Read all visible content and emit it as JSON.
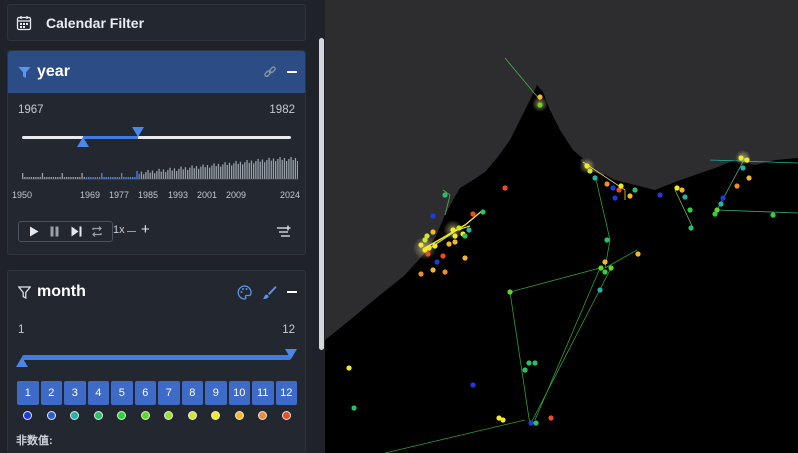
{
  "calendar_filter": {
    "title": "Calendar Filter",
    "icon": "calendar-icon"
  },
  "year_filter": {
    "title": "year",
    "range_min": "1967",
    "range_max": "1982",
    "selected_range": [
      1967,
      1982
    ],
    "axis_ticks": [
      "1950",
      "1969",
      "1977",
      "1985",
      "1993",
      "2001",
      "2009",
      "2024"
    ],
    "speed": "1x",
    "icons": [
      "filter-icon",
      "link-icon",
      "minus-icon",
      "play-icon",
      "pause-icon",
      "step-forward-icon",
      "loop-icon",
      "add-filter-icon"
    ]
  },
  "month_filter": {
    "title": "month",
    "range_min": "1",
    "range_max": "12",
    "months": [
      "1",
      "2",
      "3",
      "4",
      "5",
      "6",
      "7",
      "8",
      "9",
      "10",
      "11",
      "12"
    ],
    "month_colors": [
      "#1f3be0",
      "#2a5ec8",
      "#1fb5a8",
      "#25c26b",
      "#2bd43b",
      "#63d52a",
      "#9be22c",
      "#cfe62a",
      "#f3e924",
      "#f2b72a",
      "#f58a2a",
      "#ef4b23"
    ],
    "non_value_label": "非数值:",
    "icons": [
      "filter-outline-icon",
      "palette-icon",
      "brush-icon",
      "minus-icon"
    ]
  },
  "colors": {
    "accent": "#3f7be0",
    "header_active": "#2b4c84",
    "panel_bg": "#232830",
    "map_land": "#2d2d2f",
    "map_water": "#000000"
  }
}
